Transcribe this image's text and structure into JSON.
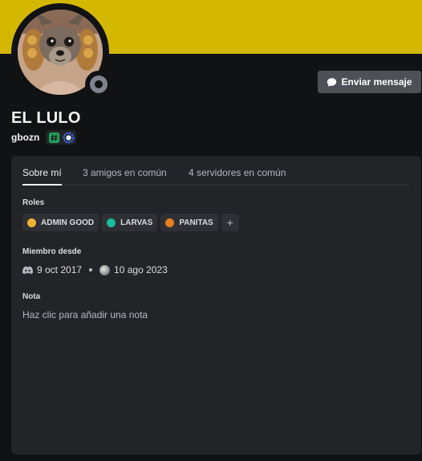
{
  "colors": {
    "banner": "#d4b800",
    "background": "#111214",
    "card": "#232428",
    "button": "#4e5058",
    "status_offline": "#80848e"
  },
  "profile": {
    "display_name": "EL LULO",
    "username": "gbozn",
    "status": "offline",
    "avatar_icon": "avatar-chihuahua-photo",
    "badges": [
      {
        "name": "hashtag-badge",
        "color": "#23a55a"
      },
      {
        "name": "nitro-boost-badge",
        "color": "#3b6fff"
      }
    ]
  },
  "actions": {
    "send_message_label": "Enviar mensaje",
    "send_message_icon": "speech-bubble-icon"
  },
  "tabs": [
    {
      "label": "Sobre mí",
      "active": true
    },
    {
      "label": "3 amigos en común",
      "active": false
    },
    {
      "label": "4 servidores en común",
      "active": false
    }
  ],
  "roles": {
    "title": "Roles",
    "items": [
      {
        "label": "ADMIN GOOD",
        "color": "#f0b232"
      },
      {
        "label": "LARVAS",
        "color": "#1abc9c"
      },
      {
        "label": "PANITAS",
        "color": "#e67e22"
      }
    ],
    "add_label": "+"
  },
  "member_since": {
    "title": "Miembro desde",
    "discord_date": "9 oct 2017",
    "server_date": "10 ago 2023",
    "discord_icon": "discord-logo-icon",
    "server_icon": "server-icon"
  },
  "note": {
    "title": "Nota",
    "placeholder": "Haz clic para añadir una nota"
  }
}
